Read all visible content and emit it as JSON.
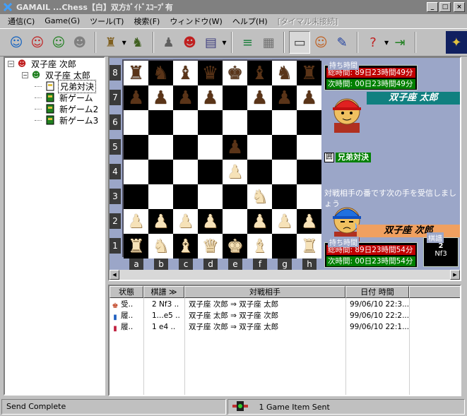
{
  "window": {
    "title": "GAMAIL ...Chess【白】双方ｶﾞｲﾄﾞｽｺｰﾌﾟ有",
    "minimize": "_",
    "maximize": "□",
    "close": "×"
  },
  "menu": [
    {
      "label": "通信(C)",
      "disabled": false
    },
    {
      "label": "Game(G)",
      "disabled": false
    },
    {
      "label": "ツール(T)",
      "disabled": false
    },
    {
      "label": "検索(F)",
      "disabled": false
    },
    {
      "label": "ウィンドウ(W)",
      "disabled": false
    },
    {
      "label": "ヘルプ(H)",
      "disabled": false
    },
    {
      "label": "[タイマル未接続]",
      "disabled": true
    }
  ],
  "toolbar_icons": [
    {
      "name": "receive-icon",
      "glyph": "☺",
      "color": "#1060c0"
    },
    {
      "name": "send-icon",
      "glyph": "☺",
      "color": "#c02020"
    },
    {
      "name": "send-receive-icon",
      "glyph": "☺",
      "color": "#208020"
    },
    {
      "name": "group-icon",
      "glyph": "☻",
      "color": "#808080"
    },
    {
      "name": "new-game-icon",
      "glyph": "♜",
      "color": "#806020"
    },
    {
      "name": "resign-icon",
      "glyph": "♞",
      "color": "#406020"
    },
    {
      "name": "players-icon",
      "glyph": "♟",
      "color": "#606060"
    },
    {
      "name": "challenge-icon",
      "glyph": "☻",
      "color": "#c02020"
    },
    {
      "name": "book-icon",
      "glyph": "▤",
      "color": "#404080"
    },
    {
      "name": "move-list-icon",
      "glyph": "≡",
      "color": "#208040"
    },
    {
      "name": "grid-icon",
      "glyph": "▦",
      "color": "#707070"
    },
    {
      "name": "document-icon",
      "glyph": "▭",
      "color": "#404040"
    },
    {
      "name": "chat-icon",
      "glyph": "☺",
      "color": "#c06020"
    },
    {
      "name": "notes-icon",
      "glyph": "✎",
      "color": "#2040a0"
    },
    {
      "name": "help-icon",
      "glyph": "?",
      "color": "#c02020"
    },
    {
      "name": "exit-icon",
      "glyph": "⇥",
      "color": "#208020"
    },
    {
      "name": "logo-icon",
      "glyph": "✦",
      "color": "#e0c040"
    }
  ],
  "tree": {
    "root": {
      "label": "双子座 次郎",
      "expander": "−"
    },
    "child": {
      "label": "双子座 太郎",
      "expander": "−"
    },
    "games": [
      {
        "label": "兄弟対決",
        "selected": true
      },
      {
        "label": "新ゲーム",
        "selected": false
      },
      {
        "label": "新ゲーム2",
        "selected": false
      },
      {
        "label": "新ゲーム3",
        "selected": false
      }
    ]
  },
  "board": {
    "ranks": [
      "8",
      "7",
      "6",
      "5",
      "4",
      "3",
      "2",
      "1"
    ],
    "files": [
      "a",
      "b",
      "c",
      "d",
      "e",
      "f",
      "g",
      "h"
    ],
    "position": [
      [
        "bR",
        "bN",
        "bB",
        "bQ",
        "bK",
        "bB",
        "bN",
        "bR"
      ],
      [
        "bP",
        "bP",
        "bP",
        "bP",
        "",
        "bP",
        "bP",
        "bP"
      ],
      [
        "",
        "",
        "",
        "",
        "",
        "",
        "",
        ""
      ],
      [
        "",
        "",
        "",
        "",
        "bP",
        "",
        "",
        ""
      ],
      [
        "",
        "",
        "",
        "",
        "wP",
        "",
        "",
        ""
      ],
      [
        "",
        "",
        "",
        "",
        "",
        "wN",
        "",
        ""
      ],
      [
        "wP",
        "wP",
        "wP",
        "wP",
        "",
        "wP",
        "wP",
        "wP"
      ],
      [
        "wR",
        "wN",
        "wB",
        "wQ",
        "wK",
        "wB",
        "",
        "wR"
      ]
    ]
  },
  "top_player": {
    "clock_header": "持ち時間",
    "total": "総時間: 89日23時間49分",
    "next": "次時間: 00日23時間49分",
    "name": "双子座 太郎",
    "namebar_color": "#108080"
  },
  "game_label": {
    "icon": "囲",
    "name": "兄弟対決"
  },
  "message": "対戦相手の番です次の手を受信しましょう",
  "bottom_player": {
    "clock_header": "持ち時間",
    "total": "総時間: 89日23時間54分",
    "next": "次時間: 00日23時間54分",
    "name": "双子座 次郎",
    "namebar_color": "#f0a060"
  },
  "kifu": {
    "header": "棋譜",
    "number": "2",
    "move": "Nf3"
  },
  "scroll": {
    "left": "◀",
    "right": "▶"
  },
  "list": {
    "headers": [
      "状態",
      "棋譜 ≫",
      "対戦相手",
      "日付  時間"
    ],
    "rows": [
      {
        "icon": "♚",
        "icon_color": "#c04020",
        "status": "受..",
        "moves": "2 Nf3 ..",
        "opponent": "双子座 次郎 ⇒ 双子座 太郎",
        "date": "99/06/10 22:3..."
      },
      {
        "icon": "▮",
        "icon_color": "#2060c0",
        "status": "履..",
        "moves": "1...e5 ..",
        "opponent": "双子座 太郎 ⇒ 双子座 次郎",
        "date": "99/06/10 22:2..."
      },
      {
        "icon": "▮",
        "icon_color": "#c02040",
        "status": "履..",
        "moves": "1 e4 ..",
        "opponent": "双子座 次郎 ⇒ 双子座 太郎",
        "date": "99/06/10 22:1..."
      }
    ]
  },
  "status": {
    "left": "Send Complete",
    "right": "1 Game Item Sent"
  }
}
